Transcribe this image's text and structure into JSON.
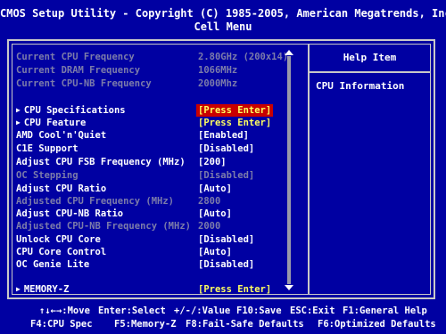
{
  "header": {
    "title": "CMOS Setup Utility - Copyright (C) 1985-2005, American Megatrends, Inc.",
    "subtitle": "Cell Menu"
  },
  "info_rows": [
    {
      "label": "Current CPU Frequency",
      "value": "2.80GHz (200x14)"
    },
    {
      "label": "Current DRAM Frequency",
      "value": "1066MHz"
    },
    {
      "label": "Current CPU-NB Frequency",
      "value": "2000Mhz"
    }
  ],
  "settings": [
    {
      "label": "CPU Specifications",
      "value": "[Press Enter]",
      "submenu": true,
      "selected": true,
      "dim": false
    },
    {
      "label": "CPU Feature",
      "value": "[Press Enter]",
      "submenu": true,
      "selected": false,
      "dim": false
    },
    {
      "label": "AMD Cool'n'Quiet",
      "value": "[Enabled]",
      "submenu": false,
      "selected": false,
      "dim": false
    },
    {
      "label": "C1E Support",
      "value": "[Disabled]",
      "submenu": false,
      "selected": false,
      "dim": false
    },
    {
      "label": "Adjust CPU FSB Frequency (MHz)",
      "value": "[200]",
      "submenu": false,
      "selected": false,
      "dim": false
    },
    {
      "label": "OC Stepping",
      "value": "[Disabled]",
      "submenu": false,
      "selected": false,
      "dim": true
    },
    {
      "label": "Adjust CPU Ratio",
      "value": "[Auto]",
      "submenu": false,
      "selected": false,
      "dim": false
    },
    {
      "label": "Adjusted CPU Frequency (MHz)",
      "value": "2800",
      "submenu": false,
      "selected": false,
      "dim": true
    },
    {
      "label": "Adjust CPU-NB Ratio",
      "value": "[Auto]",
      "submenu": false,
      "selected": false,
      "dim": false
    },
    {
      "label": "Adjusted CPU-NB Frequency (MHz)",
      "value": "2000",
      "submenu": false,
      "selected": false,
      "dim": true
    },
    {
      "label": "Unlock CPU Core",
      "value": "[Disabled]",
      "submenu": false,
      "selected": false,
      "dim": false
    },
    {
      "label": "CPU Core Control",
      "value": "[Auto]",
      "submenu": false,
      "selected": false,
      "dim": false
    },
    {
      "label": "OC Genie Lite",
      "value": "[Disabled]",
      "submenu": false,
      "selected": false,
      "dim": false
    }
  ],
  "memory_row": {
    "label": "MEMORY-Z",
    "value": "[Press Enter]"
  },
  "help": {
    "title": "Help Item",
    "text": "CPU Information"
  },
  "footer": {
    "row1": [
      "↑↓←→:Move",
      "Enter:Select",
      "+/-/:Value",
      "F10:Save",
      "ESC:Exit",
      "F1:General Help"
    ],
    "row2": [
      "F4:CPU Spec",
      "F5:Memory-Z",
      "F8:Fail-Safe Defaults",
      "F6:Optimized Defaults"
    ]
  },
  "colors": {
    "background": "#0000a2",
    "text": "#ffffff",
    "dim_text": "#7c7caa",
    "highlight_text": "#ffff60",
    "selection": "#c80000"
  }
}
